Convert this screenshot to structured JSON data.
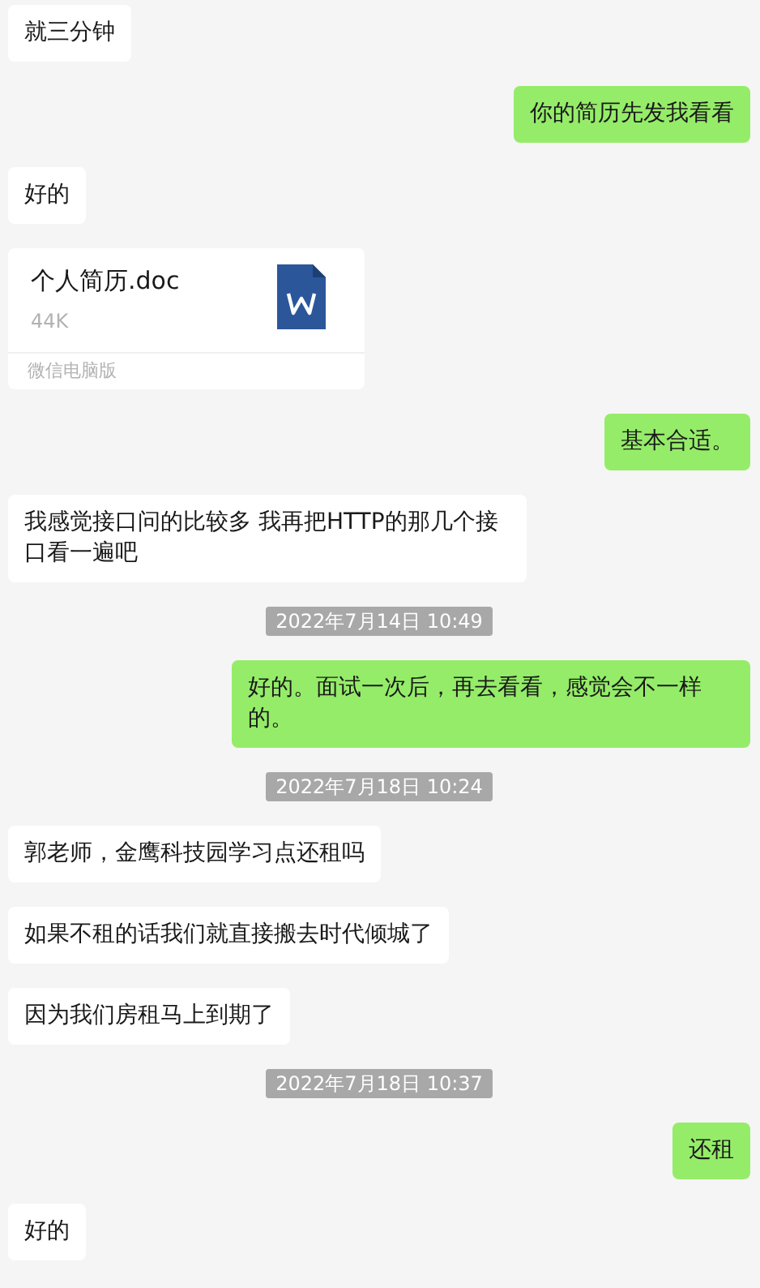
{
  "messages": [
    {
      "kind": "text",
      "outgoing": false,
      "text": "就三分钟"
    },
    {
      "kind": "text",
      "outgoing": true,
      "text": "你的简历先发我看看"
    },
    {
      "kind": "text",
      "outgoing": false,
      "text": "好的"
    },
    {
      "kind": "file",
      "file_name": "个人简历.doc",
      "size": "44K",
      "source": "微信电脑版"
    },
    {
      "kind": "text",
      "outgoing": true,
      "text": "基本合适。"
    },
    {
      "kind": "text",
      "outgoing": false,
      "text": "我感觉接口问的比较多 我再把HTTP的那几个接口看一遍吧"
    },
    {
      "kind": "time",
      "text": "2022年7月14日 10:49"
    },
    {
      "kind": "text",
      "outgoing": true,
      "text": "好的。面试一次后，再去看看，感觉会不一样的。"
    },
    {
      "kind": "time",
      "text": "2022年7月18日 10:24"
    },
    {
      "kind": "text",
      "outgoing": false,
      "text": "郭老师，金鹰科技园学习点还租吗"
    },
    {
      "kind": "text",
      "outgoing": false,
      "text": "如果不租的话我们就直接搬去时代倾城了"
    },
    {
      "kind": "text",
      "outgoing": false,
      "text": "因为我们房租马上到期了"
    },
    {
      "kind": "time",
      "text": "2022年7月18日 10:37"
    },
    {
      "kind": "text",
      "outgoing": true,
      "text": "还租"
    },
    {
      "kind": "text",
      "outgoing": false,
      "text": "好的"
    }
  ]
}
